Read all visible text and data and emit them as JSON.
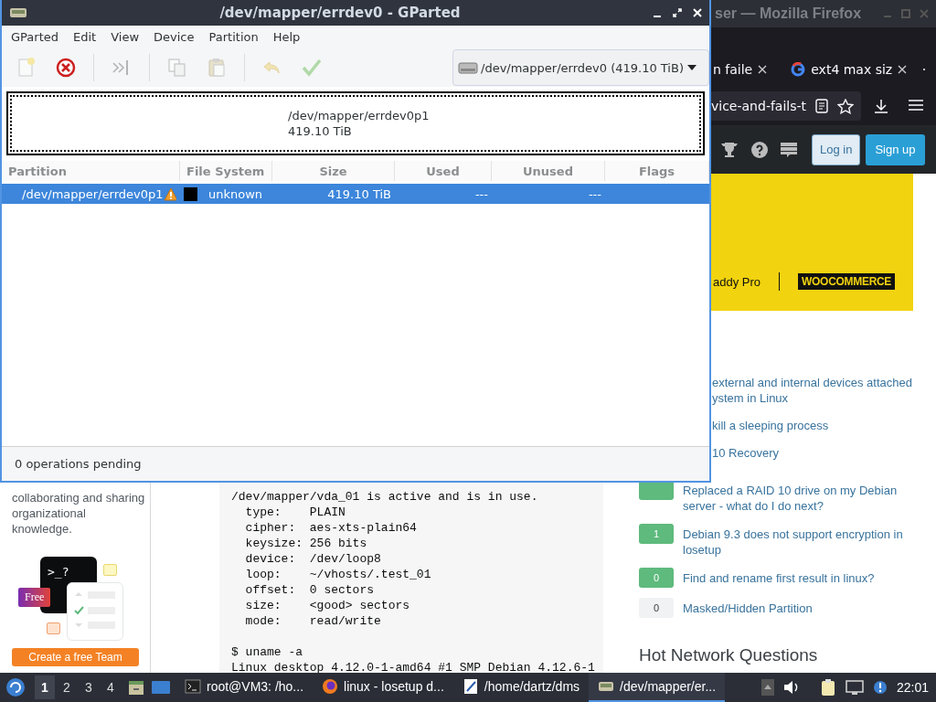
{
  "gparted": {
    "title": "/dev/mapper/errdev0 - GParted",
    "menu": [
      "GParted",
      "Edit",
      "View",
      "Device",
      "Partition",
      "Help"
    ],
    "toolbar": [
      {
        "kind": "new",
        "disabled": true
      },
      {
        "kind": "delete",
        "disabled": false
      },
      {
        "kind": "resize",
        "disabled": true
      },
      {
        "kind": "copy",
        "disabled": true
      },
      {
        "kind": "paste",
        "disabled": true
      },
      {
        "kind": "undo",
        "disabled": true
      },
      {
        "kind": "apply",
        "disabled": true
      }
    ],
    "device": "/dev/mapper/errdev0 (419.10 TiB)",
    "map": {
      "name": "/dev/mapper/errdev0p1",
      "size": "419.10 TiB"
    },
    "columns": [
      "Partition",
      "File System",
      "Size",
      "Used",
      "Unused",
      "Flags"
    ],
    "rows": [
      {
        "partition": "/dev/mapper/errdev0p1",
        "warning": true,
        "color": "#000000",
        "filesystem": "unknown",
        "size": "419.10 TiB",
        "used": "---",
        "unused": "---",
        "selected": true
      }
    ],
    "status": "0 operations pending"
  },
  "firefox": {
    "title": "ser — Mozilla Firefox",
    "tabs": [
      {
        "label": "n faile",
        "selected": false
      },
      {
        "label": "ext4 max siz",
        "selected": false
      }
    ],
    "url": "vice-and-fails-t",
    "login": "Log in",
    "signup": "Sign up",
    "ad": {
      "brand": "addy Pro",
      "brand_2": "WOOCOMMERCE"
    },
    "sidebar": {
      "text": "collaborating and sharing organizational knowledge.",
      "prompt": ">_?",
      "badge": "Free",
      "button": "Create a free Team"
    },
    "code": "/dev/mapper/vda_01 is active and is in use.\n  type:    PLAIN\n  cipher:  aes-xts-plain64\n  keysize: 256 bits\n  device:  /dev/loop8\n  loop:    ~/vhosts/.test_01\n  offset:  0 sectors\n  size:    <good> sectors\n  mode:    read/write\n\n$ uname -a\nLinux desktop 4.12.0-1-amd64 #1 SMP Debian 4.12.6-1",
    "related": [
      {
        "title": "external and internal devices attached ystem in Linux"
      },
      {
        "title": "kill a sleeping process"
      },
      {
        "title": "10 Recovery"
      },
      {
        "answered": true,
        "title": "Replaced a RAID 10 drive on my Debian server - what do I do next?"
      },
      {
        "score": "1",
        "answered": true,
        "title": "Debian 9.3 does not support encryption in losetup"
      },
      {
        "score": "0",
        "answered": true,
        "title": "Find and rename first result in linux?"
      },
      {
        "score": "0",
        "answered": false,
        "title": "Masked/Hidden Partition"
      }
    ],
    "hot_heading": "Hot Network Questions"
  },
  "taskbar": {
    "workspaces": [
      {
        "label": "1",
        "selected": true
      },
      {
        "label": "2",
        "selected": false
      },
      {
        "label": "3",
        "selected": false
      },
      {
        "label": "4",
        "selected": false
      }
    ],
    "windows": [
      {
        "kind": "terminal",
        "label": "root@VM3: /ho...",
        "selected": false
      },
      {
        "kind": "firefox",
        "label": "linux - losetup d...",
        "selected": false
      },
      {
        "kind": "editor",
        "label": "/home/dartz/dms",
        "selected": false
      },
      {
        "kind": "gparted",
        "label": "/dev/mapper/er...",
        "selected": true
      }
    ],
    "clock": "22:01"
  }
}
